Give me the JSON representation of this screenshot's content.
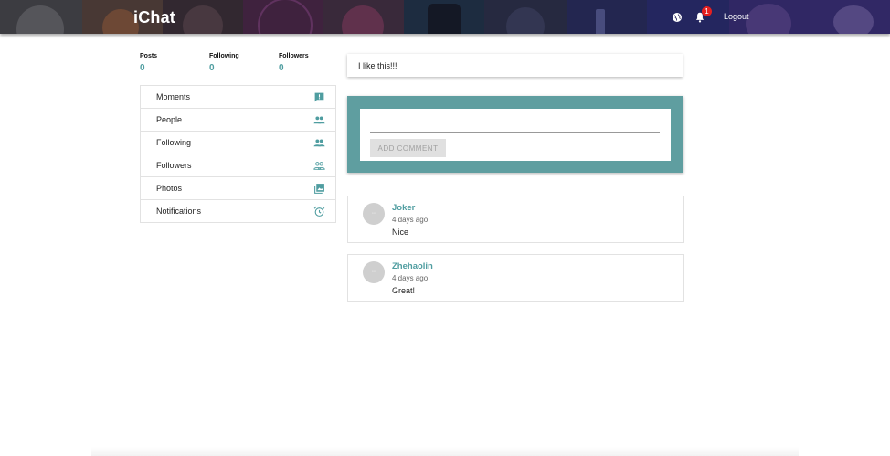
{
  "header": {
    "brand": "iChat",
    "icons": [
      "globe-icon",
      "bell-icon"
    ],
    "notification_count": "1",
    "logout_label": "Logout"
  },
  "stats": [
    {
      "label": "Posts",
      "value": "0"
    },
    {
      "label": "Following",
      "value": "0"
    },
    {
      "label": "Followers",
      "value": "0"
    }
  ],
  "menu": {
    "items": [
      {
        "label": "Moments",
        "icon": "announcement-icon"
      },
      {
        "label": "People",
        "icon": "people-icon"
      },
      {
        "label": "Following",
        "icon": "people-icon"
      },
      {
        "label": "Followers",
        "icon": "people-outline-icon"
      },
      {
        "label": "Photos",
        "icon": "photo-library-icon"
      },
      {
        "label": "Notifications",
        "icon": "alarm-icon"
      }
    ]
  },
  "post": {
    "text": "I like this!!!"
  },
  "comment_form": {
    "input_value": "",
    "button_label": "ADD COMMENT"
  },
  "comments": [
    {
      "author": "Joker",
      "time": "4 days ago",
      "text": "Nice"
    },
    {
      "author": "Zhehaolin",
      "time": "4 days ago",
      "text": "Great!"
    }
  ],
  "colors": {
    "accent": "#5f9ea0",
    "accent_text": "#4f9da0",
    "badge": "#e62020"
  }
}
